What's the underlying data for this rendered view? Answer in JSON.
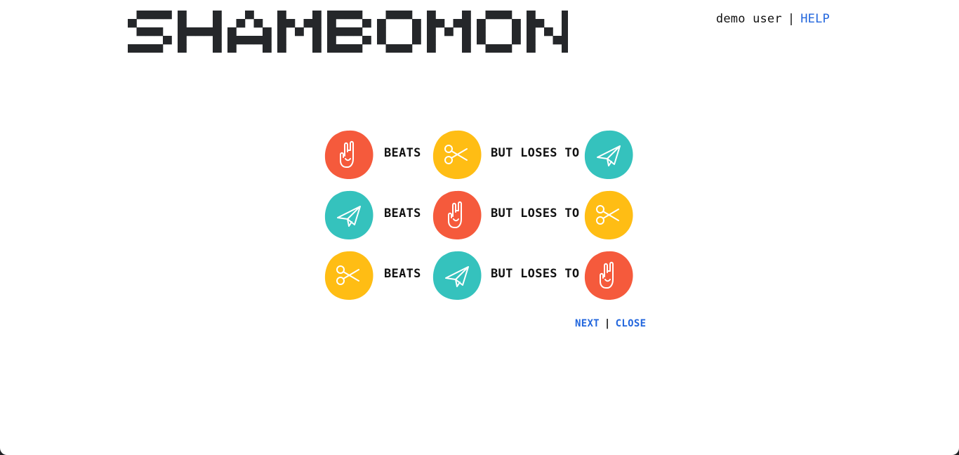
{
  "header": {
    "logo_text": "SHAMBOMON",
    "user_name": "demo user",
    "separator": "|",
    "help_label": "HELP"
  },
  "rules": [
    {
      "beats_label": "BEATS",
      "loses_label": "BUT LOSES TO",
      "piece": "rock-hand-icon",
      "beats": "scissors-icon",
      "loses_to": "paper-plane-icon"
    },
    {
      "beats_label": "BEATS",
      "loses_label": "BUT LOSES TO",
      "piece": "paper-plane-icon",
      "beats": "rock-hand-icon",
      "loses_to": "scissors-icon"
    },
    {
      "beats_label": "BEATS",
      "loses_label": "BUT LOSES TO",
      "piece": "scissors-icon",
      "beats": "paper-plane-icon",
      "loses_to": "rock-hand-icon"
    }
  ],
  "pager": {
    "next_label": "NEXT",
    "separator": "|",
    "close_label": "CLOSE"
  },
  "colors": {
    "rock": "#f55a3c",
    "scissors": "#ffbd14",
    "paper": "#35c2bd",
    "link": "#2266dd",
    "text": "#111111",
    "logo": "#25272a"
  }
}
